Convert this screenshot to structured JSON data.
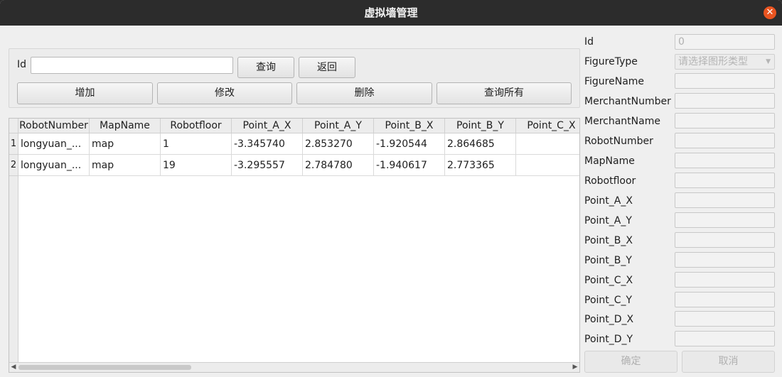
{
  "window": {
    "title": "虚拟墙管理"
  },
  "search": {
    "id_label": "Id",
    "id_value": "",
    "query_label": "查询",
    "back_label": "返回",
    "add_label": "增加",
    "modify_label": "修改",
    "delete_label": "删除",
    "query_all_label": "查询所有"
  },
  "table": {
    "columns": [
      "RobotNumber",
      "MapName",
      "Robotfloor",
      "Point_A_X",
      "Point_A_Y",
      "Point_B_X",
      "Point_B_Y",
      "Point_C_X"
    ],
    "rows": [
      {
        "num": "1",
        "cells": [
          "longyuan_...",
          "map",
          "1",
          "-3.345740",
          "2.853270",
          "-1.920544",
          "2.864685",
          ""
        ]
      },
      {
        "num": "2",
        "cells": [
          "longyuan_...",
          "map",
          "19",
          "-3.295557",
          "2.784780",
          "-1.940617",
          "2.773365",
          ""
        ]
      }
    ]
  },
  "form": {
    "id_label": "Id",
    "id_value": "0",
    "figure_type_label": "FigureType",
    "figure_type_placeholder": "请选择图形类型",
    "fields": [
      "FigureName",
      "MerchantNumber",
      "MerchantName",
      "RobotNumber",
      "MapName",
      "Robotfloor",
      "Point_A_X",
      "Point_A_Y",
      "Point_B_X",
      "Point_B_Y",
      "Point_C_X",
      "Point_C_Y",
      "Point_D_X",
      "Point_D_Y"
    ],
    "confirm_label": "确定",
    "cancel_label": "取消"
  },
  "icons": {
    "close": "close-icon",
    "scroll_left": "chevron-left-icon",
    "scroll_right": "chevron-right-icon",
    "combo": "chevron-down-icon"
  }
}
